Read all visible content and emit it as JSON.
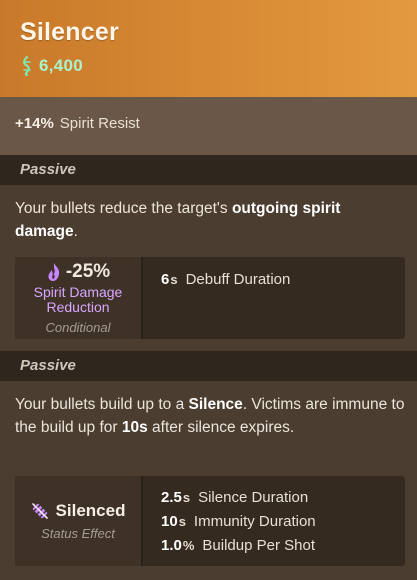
{
  "item": {
    "name": "Silencer",
    "price": "6,400",
    "price_icon": "souls-icon",
    "accent_color": "#d88b34",
    "price_color": "#a9f3c9"
  },
  "stats": {
    "value": "+14%",
    "label": "Spirit Resist"
  },
  "passive1": {
    "header": "Passive",
    "desc_before": "Your bullets reduce the target's ",
    "desc_bold": "outgoing spirit damage",
    "desc_after": ".",
    "effect": {
      "icon": "spirit-flame-icon",
      "value": "-25%",
      "name": "Spirit Damage Reduction",
      "tag": "Conditional"
    },
    "props": [
      {
        "value": "6",
        "unit": "s",
        "label": "Debuff Duration"
      }
    ]
  },
  "passive2": {
    "header": "Passive",
    "desc_1": "Your bullets build up to a ",
    "desc_bold1": "Silence",
    "desc_2": ". Victims are immune to the build up for ",
    "desc_bold2": "10s",
    "desc_3": " after silence expires.",
    "effect": {
      "icon": "silenced-icon",
      "name": "Silenced",
      "tag": "Status Effect"
    },
    "props": [
      {
        "value": "2.5",
        "unit": "s",
        "label": "Silence Duration"
      },
      {
        "value": "10",
        "unit": "s",
        "label": "Immunity Duration"
      },
      {
        "value": "1.0",
        "unit": "%",
        "label": "Buildup Per Shot"
      }
    ]
  }
}
